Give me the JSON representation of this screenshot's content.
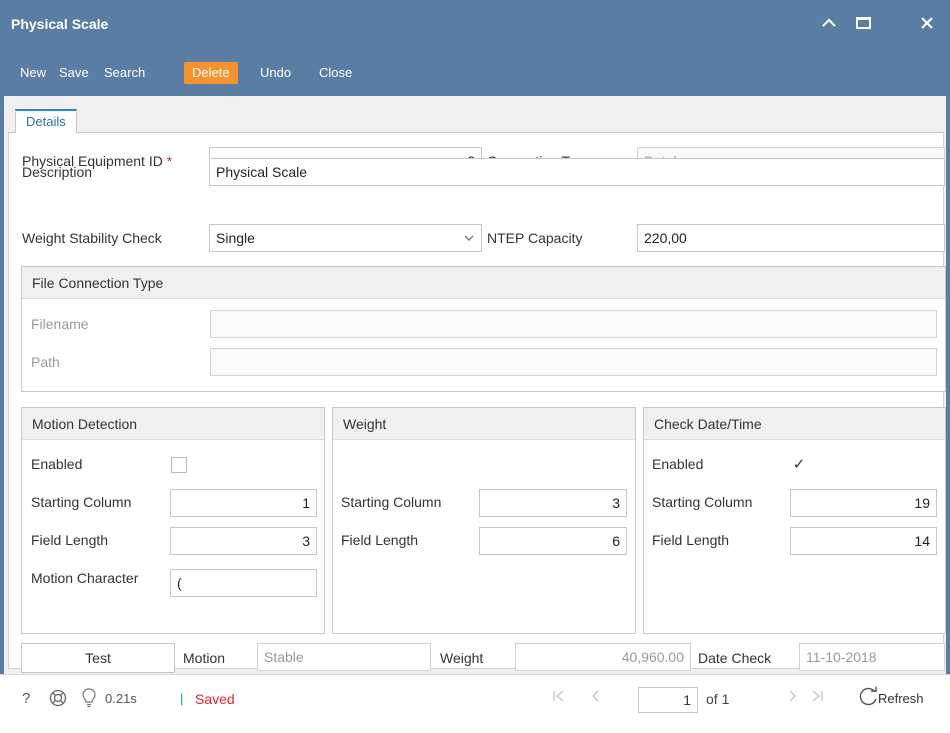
{
  "window": {
    "title": "Physical Scale"
  },
  "toolbar": {
    "new": "New",
    "save": "Save",
    "search": "Search",
    "delete": "Delete",
    "undo": "Undo",
    "close": "Close"
  },
  "tabs": [
    {
      "label": "Details"
    }
  ],
  "form": {
    "equipment_id_label": "Physical Equipment ID",
    "required_mark": "*",
    "equipment_id": "3",
    "connection_type_label": "Connection Type",
    "connection_type": "Database",
    "description_label": "Description",
    "description": "Physical Scale",
    "stability_label": "Weight Stability Check",
    "stability": "Single",
    "ntep_label": "NTEP Capacity",
    "ntep": "220,00"
  },
  "file_connection": {
    "title": "File Connection Type",
    "filename_label": "Filename",
    "filename": "",
    "path_label": "Path",
    "path": ""
  },
  "motion": {
    "title": "Motion Detection",
    "enabled_label": "Enabled",
    "enabled": false,
    "start_label": "Starting Column",
    "start": "1",
    "length_label": "Field Length",
    "length": "3",
    "char_label": "Motion Character",
    "char": "("
  },
  "weight": {
    "title": "Weight",
    "start_label": "Starting Column",
    "start": "3",
    "length_label": "Field Length",
    "length": "6"
  },
  "datetime": {
    "title": "Check Date/Time",
    "enabled_label": "Enabled",
    "enabled": true,
    "checkmark": "✓",
    "start_label": "Starting Column",
    "start": "19",
    "length_label": "Field Length",
    "length": "14"
  },
  "test": {
    "button": "Test",
    "motion_label": "Motion",
    "motion": "Stable",
    "weight_label": "Weight",
    "weight": "40,960.00",
    "date_label": "Date Check",
    "date": "11-10-2018"
  },
  "status": {
    "help": "?",
    "time": "0.21s",
    "separator": "|",
    "state": "Saved",
    "page": "1",
    "of": "of 1",
    "refresh": "Refresh"
  },
  "colors": {
    "chrome": "#5a7ea3",
    "delete": "#f7922f",
    "saved": "#e0262e",
    "tab_accent": "#2a86c8"
  }
}
